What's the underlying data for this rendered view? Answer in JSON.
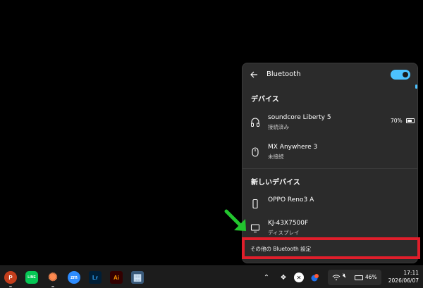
{
  "flyout": {
    "title": "Bluetooth",
    "toggle_on": true,
    "devices_header": "デバイス",
    "devices": [
      {
        "name": "soundcore Liberty 5",
        "status": "接続済み",
        "battery": "70%",
        "icon": "headphones-icon"
      },
      {
        "name": "MX Anywhere 3",
        "status": "未接続",
        "icon": "mouse-icon"
      }
    ],
    "new_devices_header": "新しいデバイス",
    "new_devices": [
      {
        "name": "OPPO Reno3 A",
        "status": "",
        "icon": "phone-icon"
      },
      {
        "name": "KJ-43X7500F",
        "status": "ディスプレイ",
        "icon": "display-icon"
      }
    ],
    "more_settings": "その他の Bluetooth 設定"
  },
  "taskbar": {
    "apps": [
      {
        "name": "powerpoint",
        "label": "P",
        "color": "#c43e1c"
      },
      {
        "name": "line",
        "label": "LINE",
        "color": "#06c755"
      },
      {
        "name": "burst-app",
        "label": "✺",
        "color": "#1c1c1c"
      },
      {
        "name": "zoom",
        "label": "zm",
        "color": "#2d8cff"
      },
      {
        "name": "lightroom",
        "label": "Lr",
        "color": "#001e36"
      },
      {
        "name": "illustrator",
        "label": "Ai",
        "color": "#330000"
      },
      {
        "name": "calculator",
        "label": "▦",
        "color": "#3a5a7a"
      }
    ],
    "battery": "46%",
    "time": "17:11",
    "date": "2026/06/07"
  },
  "colors": {
    "accent": "#4cc2ff",
    "highlight": "#e01e2b",
    "arrow": "#22c52e"
  }
}
